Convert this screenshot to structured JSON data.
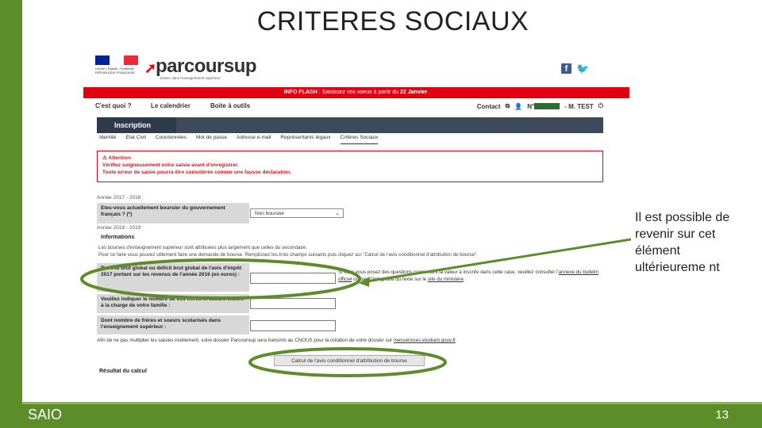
{
  "slide": {
    "title": "CRITERES SOCIAUX",
    "footer_left": "SAIO",
    "page_number": "13",
    "accent_color": "#5d8d29",
    "note": "Il est possible de revenir sur cet élément ultérieureme nt"
  },
  "screenshot": {
    "gov_logo_text": "Liberté • Égalité • Fraternité RÉPUBLIQUE FRANÇAISE",
    "app_name": "parcoursup",
    "app_tagline": "Entrez dans l'enseignement supérieur",
    "social_icons": [
      "facebook-icon",
      "twitter-icon"
    ],
    "flash": {
      "label": "INFO FLASH",
      "text_prefix": " : Saisissez vos voeux à partir du ",
      "date": "22 Janvier",
      "suffix": "."
    },
    "nav": {
      "items": [
        "C'est quoi ?",
        "Le calendrier",
        "Boite à outils"
      ],
      "contact": "Contact",
      "user_prefix": "N°",
      "user_name": "- M. TEST"
    },
    "section_tab": "Inscription",
    "subtabs": [
      "Identité",
      "Etat Civil",
      "Coordonnées",
      "Mot de passe",
      "Adresse e-mail",
      "Représentants légaux",
      "Critères Sociaux"
    ],
    "alert": {
      "title": "Attention",
      "line1": "Vérifiez soigneusement votre saisie avant d'enregistrer.",
      "line2": "Toute erreur de saisie pourra être considérée comme une fausse déclaration."
    },
    "year1": "Année 2017 - 2018 :",
    "q_boursier": "Etes-vous actuellement boursier du gouvernement français ? (*)",
    "select_value": "Non boursier",
    "year2": "Année 2018 - 2019 :",
    "info_heading": "Informations",
    "info_line1": "Les bourses d'enseignement supérieur sont attribuées plus largement que celles du secondaire.",
    "info_line2": "Pour ce faire vous pouvez utilement faire une demande de bourse. Remplissez les trois champs suivants puis cliquez sur \"Calcul de l'avis conditionnel d'attribution de bourse\".",
    "q_revenu": "Revenu brut global ou déficit brut global de l'avis d'impôt 2017 portant sur les revenus de l'année 2016 (en euros) :",
    "q_freres": "Veuillez indiquer le nombre de vos frères et soeurs encore à la charge de votre famille :",
    "q_scolarises": "Dont nombre de frères et soeurs scolarisés dans l'enseignement supérieur :",
    "side_note_prefix": "Si vous vous posez des questions concernant la valeur à inscrire dans cette case, veuillez consulter l'",
    "side_note_link1": "annexe du bulletin officiel",
    "side_note_mid": " ou bien l'intégralité du texte sur le ",
    "side_note_link2": "site du ministère",
    "side_note_end": ".",
    "bottom_note_prefix": "Afin de ne pas multiplier les saisies inutilement, votre dossier Parcoursup sera transmis au CNOUS pour la création de votre dossier sur ",
    "bottom_note_link": "messervices.etudiant.gouv.fr",
    "bottom_note_end": ".",
    "calc_button": "Calcul de l'avis conditionnel d'attribution de bourse",
    "result_label": "Résultat du calcul"
  }
}
